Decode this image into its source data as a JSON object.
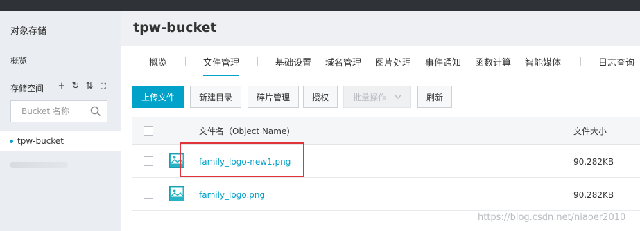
{
  "sidebar": {
    "title": "对象存储",
    "overview": "概览",
    "storage_label": "存储空间",
    "tools": {
      "add": "+",
      "refresh": "↻",
      "sort": "⇅",
      "expand": "⛶"
    },
    "search_placeholder": "Bucket 名称",
    "active_bucket": "tpw-bucket"
  },
  "header": {
    "title": "tpw-bucket"
  },
  "tabs": [
    "概览",
    "文件管理",
    "基础设置",
    "域名管理",
    "图片处理",
    "事件通知",
    "函数计算",
    "智能媒体",
    "日志查询"
  ],
  "toolbar": {
    "upload": "上传文件",
    "new_dir": "新建目录",
    "fragments": "碎片管理",
    "authorize": "授权",
    "batch": "批量操作",
    "refresh": "刷新"
  },
  "table": {
    "headers": {
      "name": "文件名（Object Name)",
      "size": "文件大小"
    },
    "rows": [
      {
        "name": "family_logo-new1.png",
        "size": "90.282KB"
      },
      {
        "name": "family_logo.png",
        "size": "90.282KB"
      }
    ]
  },
  "colors": {
    "accent": "#00a2ca",
    "highlight": "#e0333a",
    "sidebar_bg": "#eaedf1"
  },
  "watermark": "https://blog.csdn.net/niaoer2010"
}
